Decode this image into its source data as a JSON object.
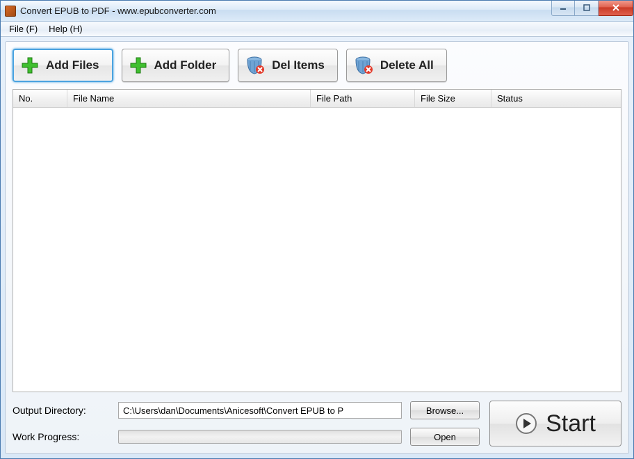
{
  "window": {
    "title": "Convert EPUB to PDF - www.epubconverter.com"
  },
  "menu": {
    "file": "File (F)",
    "help": "Help (H)"
  },
  "toolbar": {
    "add_files": "Add Files",
    "add_folder": "Add Folder",
    "del_items": "Del Items",
    "delete_all": "Delete All"
  },
  "columns": {
    "no": "No.",
    "name": "File Name",
    "path": "File Path",
    "size": "File Size",
    "status": "Status"
  },
  "files": [],
  "output": {
    "label": "Output Directory:",
    "path": "C:\\Users\\dan\\Documents\\Anicesoft\\Convert EPUB to P",
    "browse": "Browse...",
    "open": "Open"
  },
  "progress": {
    "label": "Work Progress:"
  },
  "start": {
    "label": "Start"
  }
}
